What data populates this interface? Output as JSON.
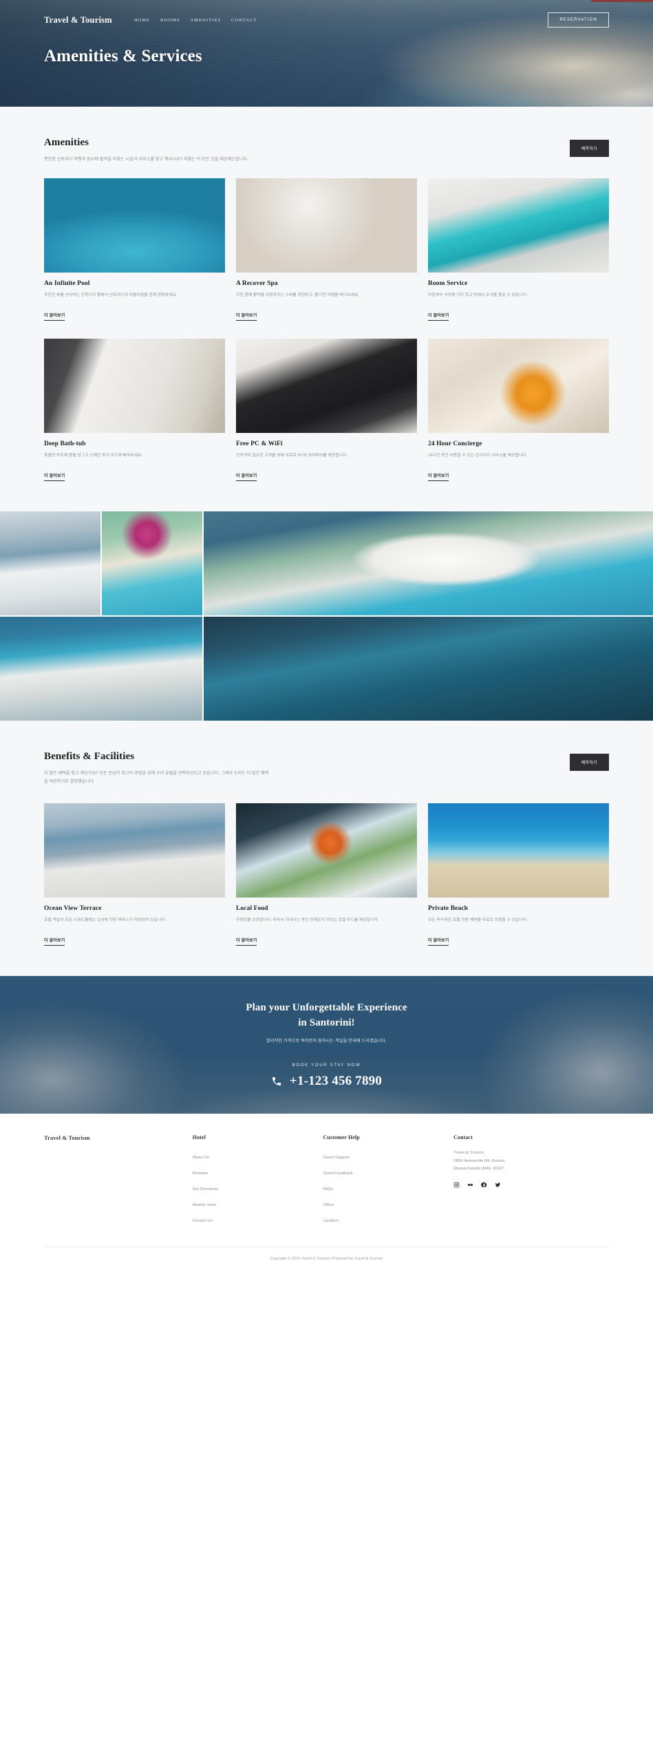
{
  "brand": "Travel & Tourism",
  "nav": {
    "links": [
      {
        "label": "HOME"
      },
      {
        "label": "ROOMS"
      },
      {
        "label": "AMENITIES"
      },
      {
        "label": "CONTACT"
      }
    ],
    "reserve_label": "RESERVATION"
  },
  "hero": {
    "title": "Amenities & Services"
  },
  "amenities": {
    "title": "Amenities",
    "desc": "편안한 산토리니 여행과 동시에 활력을 되찾는 시설과 서비스를 찾고 계시나요? 저희는 이 모든 것을 제공해드립니다.",
    "cta_label": "예약하기",
    "more_label": "더 알아보기",
    "cards": [
      {
        "title": "An Infinite Pool",
        "desc": "무한한 뷰를 선사하는 인피니티 풀에서 산토리니의 아름다움을 함께 경험하세요.",
        "image": "infinity-pool-photo"
      },
      {
        "title": "A Recover Spa",
        "desc": "지친 몸에 활력을 되찾아주는 스파를 경험하고, 활기찬 여행을 떠나보세요.",
        "image": "spa-treatment-photo"
      },
      {
        "title": "Room Service",
        "desc": "아침부터 식당에 가지 않고 방에서 조식을 즐길 수 있습니다.",
        "image": "hotel-room-photo"
      },
      {
        "title": "Deep Bath-tub",
        "desc": "특별한 욕조에 몸을 담그고 상쾌한 휴가 모드에 빠져보세요.",
        "image": "bathtub-photo"
      },
      {
        "title": "Free PC & WiFi",
        "desc": "인터넷이 필요한 고객을 위해 무료로 PC와 와이파이를 제공합니다.",
        "image": "laptop-desk-photo"
      },
      {
        "title": "24 Hour Concierge",
        "desc": "24시간 동안 이용할 수 있는 컨시어지 서비스를 제공합니다.",
        "image": "breakfast-service-photo"
      }
    ]
  },
  "gallery": {
    "items": [
      {
        "image": "santorini-white-terrace-photo"
      },
      {
        "image": "poolside-loungers-bougainvillea-photo"
      },
      {
        "image": "pool-umbrella-sea-view-photo"
      },
      {
        "image": "cliffside-infinity-pool-photo"
      },
      {
        "image": "blue-terrace-night-photo"
      },
      {
        "image": "outdoor-dining-table-photo"
      }
    ]
  },
  "benefits": {
    "title": "Benefits & Facilities",
    "desc": "더 많은 혜택을 찾고 계신가요? 모든 손님이 최고의 경험을 위해 우리 호텔을 선택하신다고 믿습니다. 그래서 우리는 더 많은 혜택을 제공하기로 결정했습니다.",
    "cta_label": "예약하기",
    "more_label": "더 알아보기",
    "cards": [
      {
        "title": "Ocean View Terrace",
        "desc": "호텔 객실의 모든 스위트룸에는 오션뷰 전망 테라스가 마련되어 있습니다.",
        "image": "ocean-view-terrace-photo"
      },
      {
        "title": "Local Food",
        "desc": "주방장을 보유합니다. 따라서 지내시는 동안 언제든지 맛있는 로컬 푸드를 제공합니다.",
        "image": "local-food-cocktail-photo"
      },
      {
        "title": "Private Beach",
        "desc": "모든 투숙객은 호텔 전용 해변을 무료로 이용할 수 있습니다.",
        "image": "private-beach-photo"
      }
    ]
  },
  "cta": {
    "title_line1": "Plan your Unforgettable Experience",
    "title_line2": "in Santorini!",
    "subtitle": "합리적인 가격으로 여러분이 원하시는 객실을 안내해 드리겠습니다.",
    "label": "BOOK YOUR STAY NOW",
    "phone": "+1-123 456 7890"
  },
  "footer": {
    "brand": "Travel & Tourism",
    "columns": [
      {
        "heading": "Hotel",
        "links": [
          "About Us",
          "Reviews",
          "Get Directions",
          "Nearby Visits",
          "Contact Us"
        ]
      },
      {
        "heading": "Customer Help",
        "links": [
          "Guest Support",
          "Guest Feedback",
          "FAQs",
          "Offers",
          "Location"
        ]
      }
    ],
    "contact": {
      "heading": "Contact",
      "address_line1": "Travel & Tourism,",
      "address_line2": "2855 Nelsonville Rd, Boston,",
      "address_line3": "Massachusetts (MA), 40107",
      "socials": [
        "instagram-icon",
        "flickr-icon",
        "facebook-icon",
        "twitter-icon"
      ]
    },
    "copyright": "Copyright © 2024 Travel & Tourism | Powered by Travel & Tourism"
  }
}
